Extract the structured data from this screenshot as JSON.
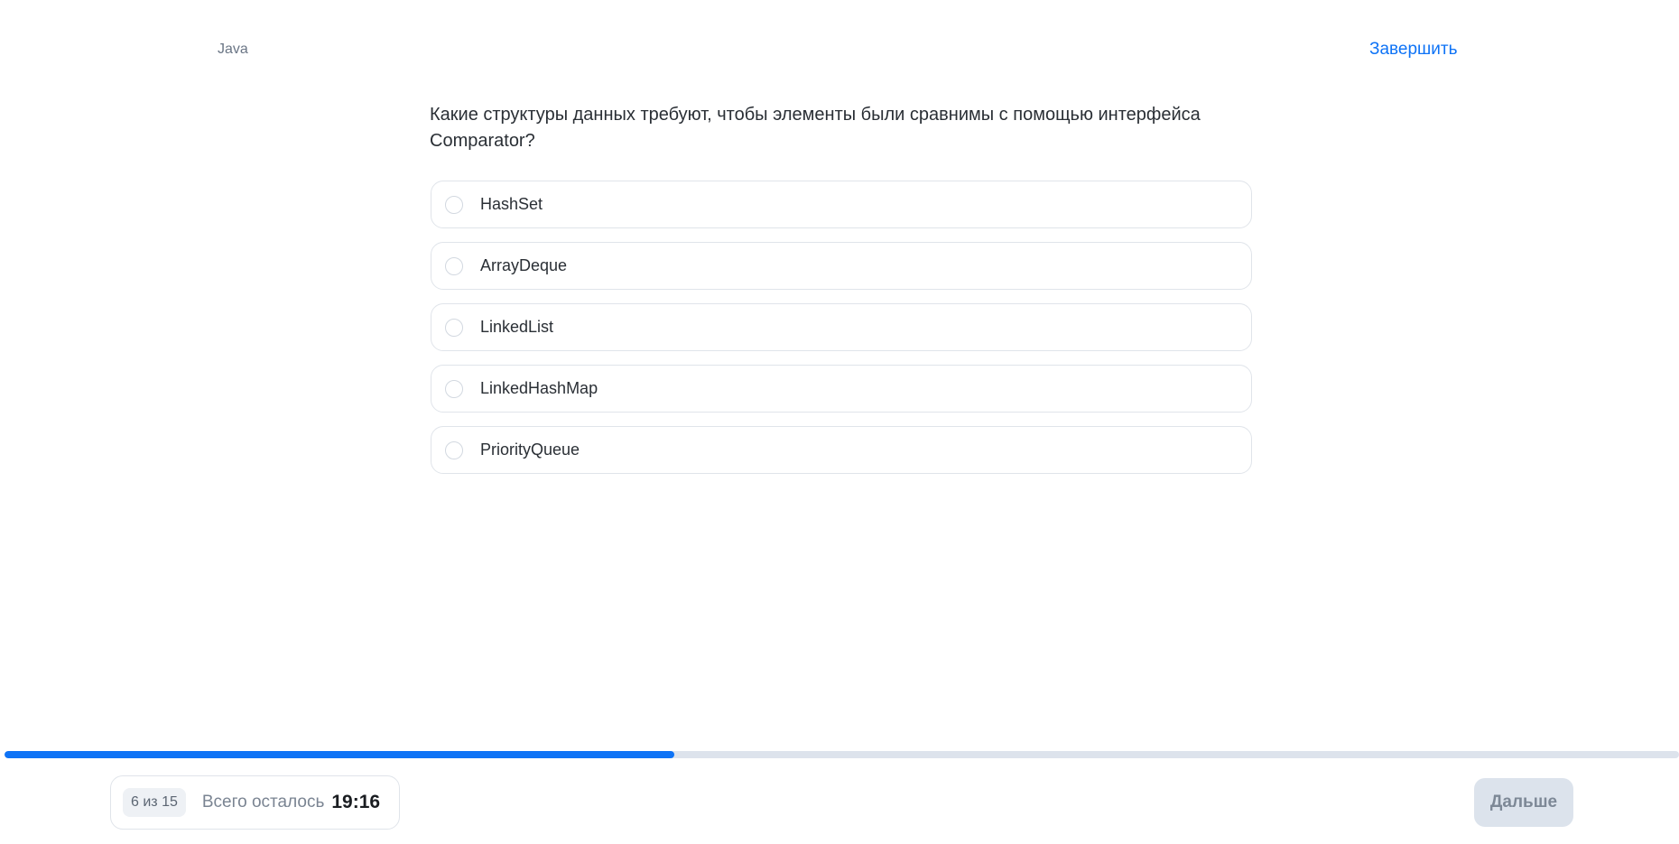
{
  "header": {
    "topic": "Java",
    "finish_label": "Завершить"
  },
  "question": {
    "text": "Какие структуры данных требуют, чтобы элементы были сравнимы с помощью интерфейса Comparator?",
    "options": [
      {
        "label": "HashSet",
        "selected": false
      },
      {
        "label": "ArrayDeque",
        "selected": false
      },
      {
        "label": "LinkedList",
        "selected": false
      },
      {
        "label": "LinkedHashMap",
        "selected": false
      },
      {
        "label": "PriorityQueue",
        "selected": false
      }
    ]
  },
  "progress": {
    "fraction": 0.4,
    "fill_color": "#0e73f6",
    "track_color": "#dde3ec"
  },
  "footer": {
    "counter": "6 из 15",
    "remaining_label": "Всего осталось",
    "timer": "19:16",
    "next_label": "Дальше"
  }
}
